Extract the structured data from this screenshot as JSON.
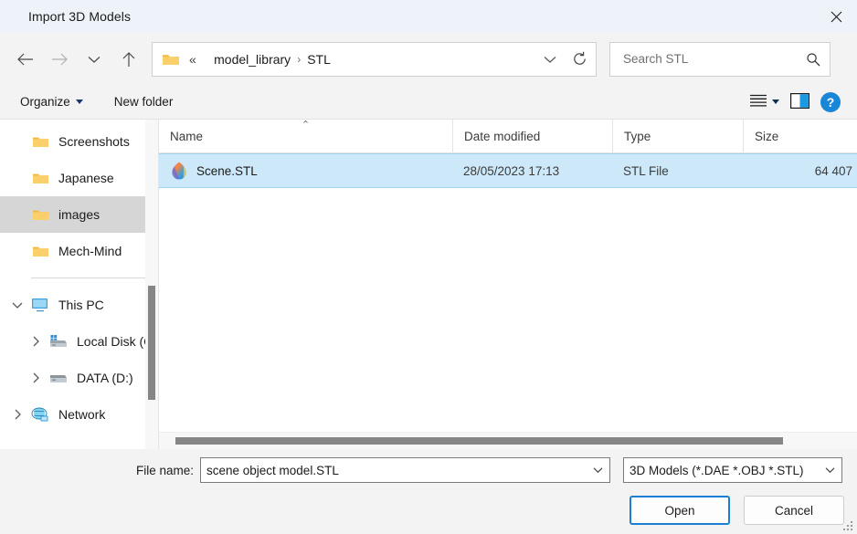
{
  "window": {
    "title": "Import 3D Models",
    "close_icon": "close-icon"
  },
  "nav": {
    "back_icon": "arrow-left-icon",
    "forward_icon": "arrow-right-icon",
    "recent_icon": "chevron-down-icon",
    "up_icon": "arrow-up-icon",
    "breadcrumb": {
      "folder_icon": "folder-icon",
      "overflow": "«",
      "items": [
        "model_library",
        "STL"
      ],
      "separator": "›",
      "dropdown_icon": "chevron-down-icon",
      "refresh_icon": "refresh-icon"
    },
    "search": {
      "placeholder": "Search STL",
      "value": "",
      "icon": "search-icon"
    }
  },
  "commandbar": {
    "organize_label": "Organize",
    "organize_icon": "caret-down-icon",
    "new_folder_label": "New folder",
    "view_icon": "list-view-icon",
    "view_dropdown_icon": "caret-down-icon",
    "preview_pane_icon": "preview-pane-icon",
    "help_icon": "help-icon",
    "help_glyph": "?"
  },
  "sidebar": {
    "items": [
      {
        "label": "Screenshots",
        "icon": "folder-icon",
        "indent": 1,
        "expander": "",
        "selected": false
      },
      {
        "label": "Japanese",
        "icon": "folder-icon",
        "indent": 1,
        "expander": "",
        "selected": false
      },
      {
        "label": "images",
        "icon": "folder-icon",
        "indent": 1,
        "expander": "",
        "selected": true
      },
      {
        "label": "Mech-Mind",
        "icon": "folder-icon",
        "indent": 1,
        "expander": "",
        "selected": false
      }
    ],
    "items2": [
      {
        "label": "This PC",
        "icon": "monitor-icon",
        "indent": 0,
        "expander": "chevron-down-icon",
        "selected": false
      },
      {
        "label": "Local Disk (C:)",
        "icon": "system-drive-icon",
        "indent": 1,
        "expander": "chevron-right-icon",
        "selected": false
      },
      {
        "label": "DATA (D:)",
        "icon": "drive-icon",
        "indent": 1,
        "expander": "chevron-right-icon",
        "selected": false
      },
      {
        "label": "Network",
        "icon": "network-icon",
        "indent": 0,
        "expander": "chevron-right-icon",
        "selected": false
      }
    ],
    "scrollbar": "vertical-scrollbar"
  },
  "filelist": {
    "columns": [
      {
        "label": "Name",
        "sorted": "asc",
        "sort_glyph": "⌃"
      },
      {
        "label": "Date modified",
        "sorted": "",
        "sort_glyph": ""
      },
      {
        "label": "Type",
        "sorted": "",
        "sort_glyph": ""
      },
      {
        "label": "Size",
        "sorted": "",
        "sort_glyph": ""
      }
    ],
    "rows": [
      {
        "name": "Scene.STL",
        "date_modified": "28/05/2023 17:13",
        "type": "STL File",
        "size": "64 407",
        "icon": "stl-file-icon",
        "selected": true
      }
    ],
    "hscrollbar": "horizontal-scrollbar"
  },
  "footer": {
    "filename_label": "File name:",
    "filename_value": "scene object model.STL",
    "filename_placeholder": "",
    "filename_dropdown_icon": "chevron-down-icon",
    "filter_value": "3D Models (*.DAE *.OBJ *.STL)",
    "filter_dropdown_icon": "chevron-down-icon",
    "open_label": "Open",
    "cancel_label": "Cancel",
    "resize_grip": "resize-grip"
  },
  "colors": {
    "titlebar": "#eef3fa",
    "accent": "#1a7fd4",
    "selection": "#cde8f9",
    "selection_border": "#9fd3f0",
    "tree_selection": "#d6d6d6",
    "chrome": "#f3f3f3",
    "folder": "#f7c64f"
  }
}
